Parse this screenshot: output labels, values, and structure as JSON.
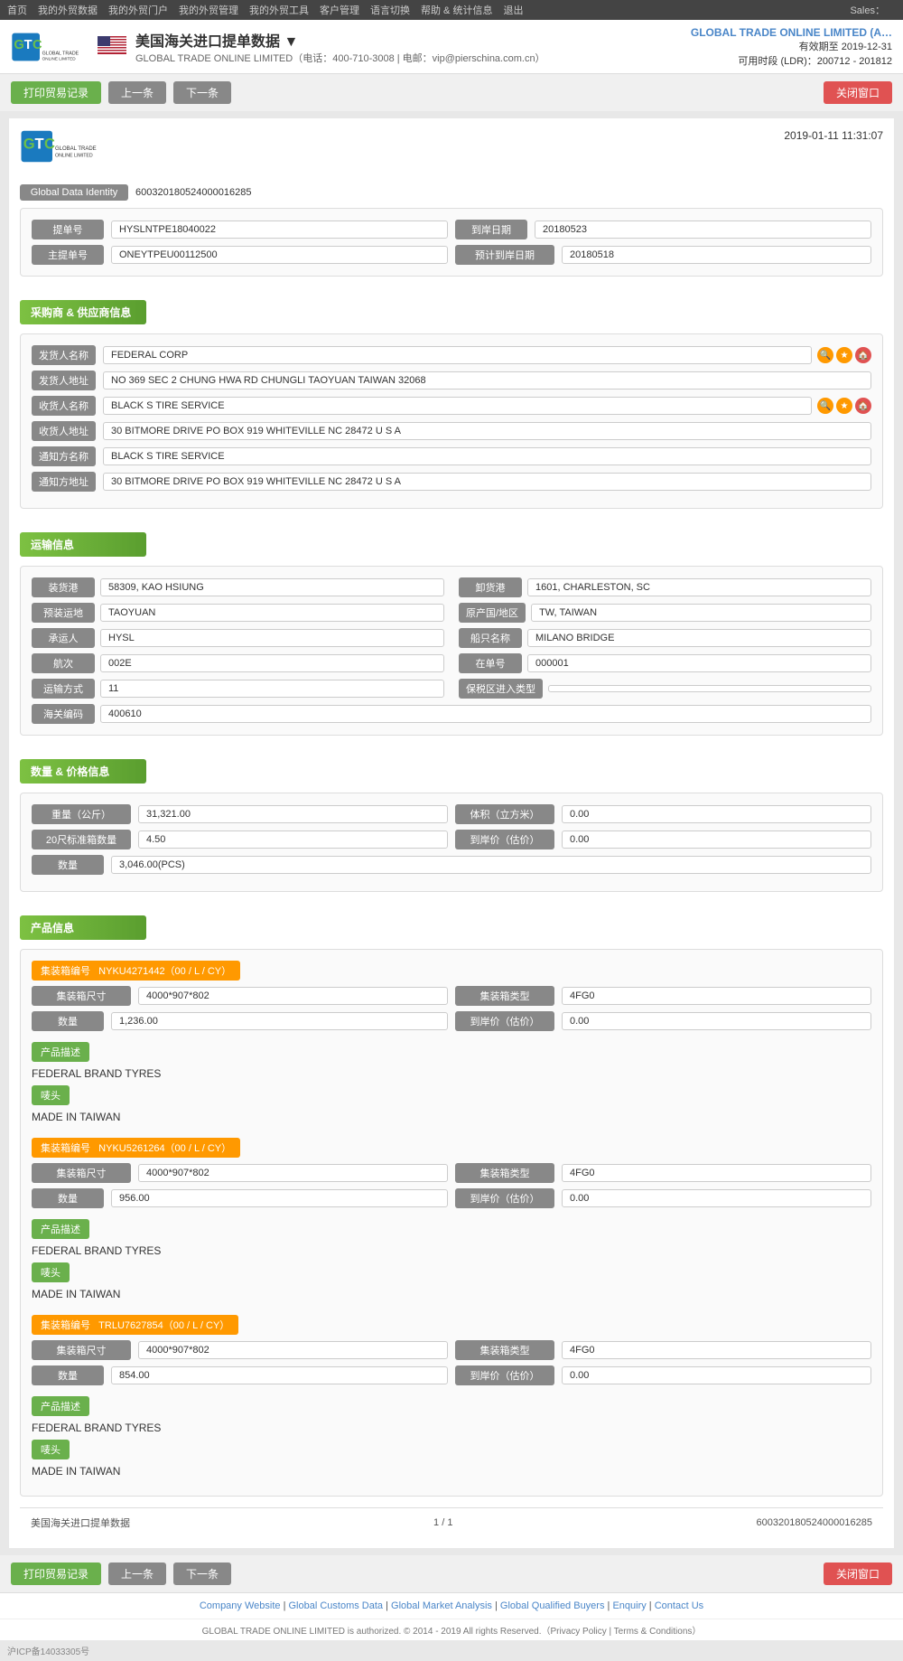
{
  "topnav": {
    "items": [
      "首页",
      "我的外贸数据",
      "我的外贸门户",
      "我的外贸管理",
      "我的外贸工具",
      "客户管理",
      "语言切换",
      "帮助 & 统计信息",
      "退出"
    ],
    "sales": "Sales："
  },
  "header": {
    "title": "美国海关进口提单数据 ▼",
    "company_info": "GLOBAL TRADE ONLINE LIMITED（电话：400-710-3008 | 电邮：vip@pierschina.com.cn）",
    "brand": "GLOBAL TRADE ONLINE LIMITED (A…",
    "valid_until": "有效期至 2019-12-31",
    "available_time": "可用时段 (LDR)：200712 - 201812"
  },
  "toolbar": {
    "print_btn": "打印贸易记录",
    "prev_btn": "上一条",
    "next_btn": "下一条",
    "close_btn": "关闭窗口"
  },
  "doc": {
    "timestamp": "2019-01-11 11:31:07",
    "global_data_label": "Global Data Identity",
    "global_data_value": "600320180524000016285",
    "fields": {
      "bill_no_label": "提单号",
      "bill_no_value": "HYSLNTPE18040022",
      "arrival_date_label": "到岸日期",
      "arrival_date_value": "20180523",
      "master_bill_label": "主提单号",
      "master_bill_value": "ONEYTPEU00112500",
      "plan_arrival_label": "预计到岸日期",
      "plan_arrival_value": "20180518"
    }
  },
  "buyer_supplier": {
    "section_title": "采购商 & 供应商信息",
    "shipper_name_label": "发货人名称",
    "shipper_name_value": "FEDERAL CORP",
    "shipper_addr_label": "发货人地址",
    "shipper_addr_value": "NO 369 SEC 2 CHUNG HWA RD CHUNGLI TAOYUAN TAIWAN 32068",
    "consignee_name_label": "收货人名称",
    "consignee_name_value": "BLACK S TIRE SERVICE",
    "consignee_addr_label": "收货人地址",
    "consignee_addr_value": "30 BITMORE DRIVE PO BOX 919 WHITEVILLE NC 28472 U S A",
    "notify_name_label": "通知方名称",
    "notify_name_value": "BLACK S TIRE SERVICE",
    "notify_addr_label": "通知方地址",
    "notify_addr_value": "30 BITMORE DRIVE PO BOX 919 WHITEVILLE NC 28472 U S A"
  },
  "transport": {
    "section_title": "运输信息",
    "load_port_label": "装货港",
    "load_port_value": "58309, KAO HSIUNG",
    "unload_port_label": "卸货港",
    "unload_port_value": "1601, CHARLESTON, SC",
    "pre_load_label": "预装运地",
    "pre_load_value": "TAOYUAN",
    "origin_label": "原产国/地区",
    "origin_value": "TW, TAIWAN",
    "carrier_label": "承运人",
    "carrier_value": "HYSL",
    "vessel_label": "船只名称",
    "vessel_value": "MILANO BRIDGE",
    "voyage_label": "航次",
    "voyage_value": "002E",
    "in_bond_label": "在单号",
    "in_bond_value": "000001",
    "transport_mode_label": "运输方式",
    "transport_mode_value": "11",
    "bonded_type_label": "保税区进入类型",
    "bonded_type_value": "",
    "customs_code_label": "海关编码",
    "customs_code_value": "400610"
  },
  "quantity_price": {
    "section_title": "数量 & 价格信息",
    "weight_label": "重量（公斤）",
    "weight_value": "31,321.00",
    "volume_label": "体积（立方米）",
    "volume_value": "0.00",
    "teu_label": "20尺标准箱数量",
    "teu_value": "4.50",
    "arrival_price_label": "到岸价（估价）",
    "arrival_price_value": "0.00",
    "quantity_label": "数量",
    "quantity_value": "3,046.00(PCS)"
  },
  "product_info": {
    "section_title": "产品信息",
    "containers": [
      {
        "container_no_label": "集装箱编号",
        "container_no_value": "NYKU4271442（00 / L / CY）",
        "container_size_label": "集装箱尺寸",
        "container_size_value": "4000*907*802",
        "container_type_label": "集装箱类型",
        "container_type_value": "4FG0",
        "quantity_label": "数量",
        "quantity_value": "1,236.00",
        "arrival_price_label": "到岸价（估价）",
        "arrival_price_value": "0.00",
        "product_desc_label": "产品描述",
        "product_desc_value": "FEDERAL BRAND TYRES",
        "marks_label": "唛头",
        "marks_value": "MADE IN TAIWAN"
      },
      {
        "container_no_label": "集装箱编号",
        "container_no_value": "NYKU5261264（00 / L / CY）",
        "container_size_label": "集装箱尺寸",
        "container_size_value": "4000*907*802",
        "container_type_label": "集装箱类型",
        "container_type_value": "4FG0",
        "quantity_label": "数量",
        "quantity_value": "956.00",
        "arrival_price_label": "到岸价（估价）",
        "arrival_price_value": "0.00",
        "product_desc_label": "产品描述",
        "product_desc_value": "FEDERAL BRAND TYRES",
        "marks_label": "唛头",
        "marks_value": "MADE IN TAIWAN"
      },
      {
        "container_no_label": "集装箱编号",
        "container_no_value": "TRLU7627854（00 / L / CY）",
        "container_size_label": "集装箱尺寸",
        "container_size_value": "4000*907*802",
        "container_type_label": "集装箱类型",
        "container_type_value": "4FG0",
        "quantity_label": "数量",
        "quantity_value": "854.00",
        "arrival_price_label": "到岸价（估价）",
        "arrival_price_value": "0.00",
        "product_desc_label": "产品描述",
        "product_desc_value": "FEDERAL BRAND TYRES",
        "marks_label": "唛头",
        "marks_value": "MADE IN TAIWAN"
      }
    ]
  },
  "doc_footer": {
    "label": "美国海关进口提单数据",
    "page": "1 / 1",
    "record_id": "600320180524000016285"
  },
  "footer": {
    "icp": "沪ICP备14033305号",
    "links": [
      "Company Website",
      "Global Customs Data",
      "Global Market Analysis",
      "Global Qualified Buyers",
      "Enquiry",
      "Contact Us"
    ],
    "copyright": "GLOBAL TRADE ONLINE LIMITED is authorized. © 2014 - 2019 All rights Reserved.（Privacy Policy | Terms & Conditions）"
  }
}
